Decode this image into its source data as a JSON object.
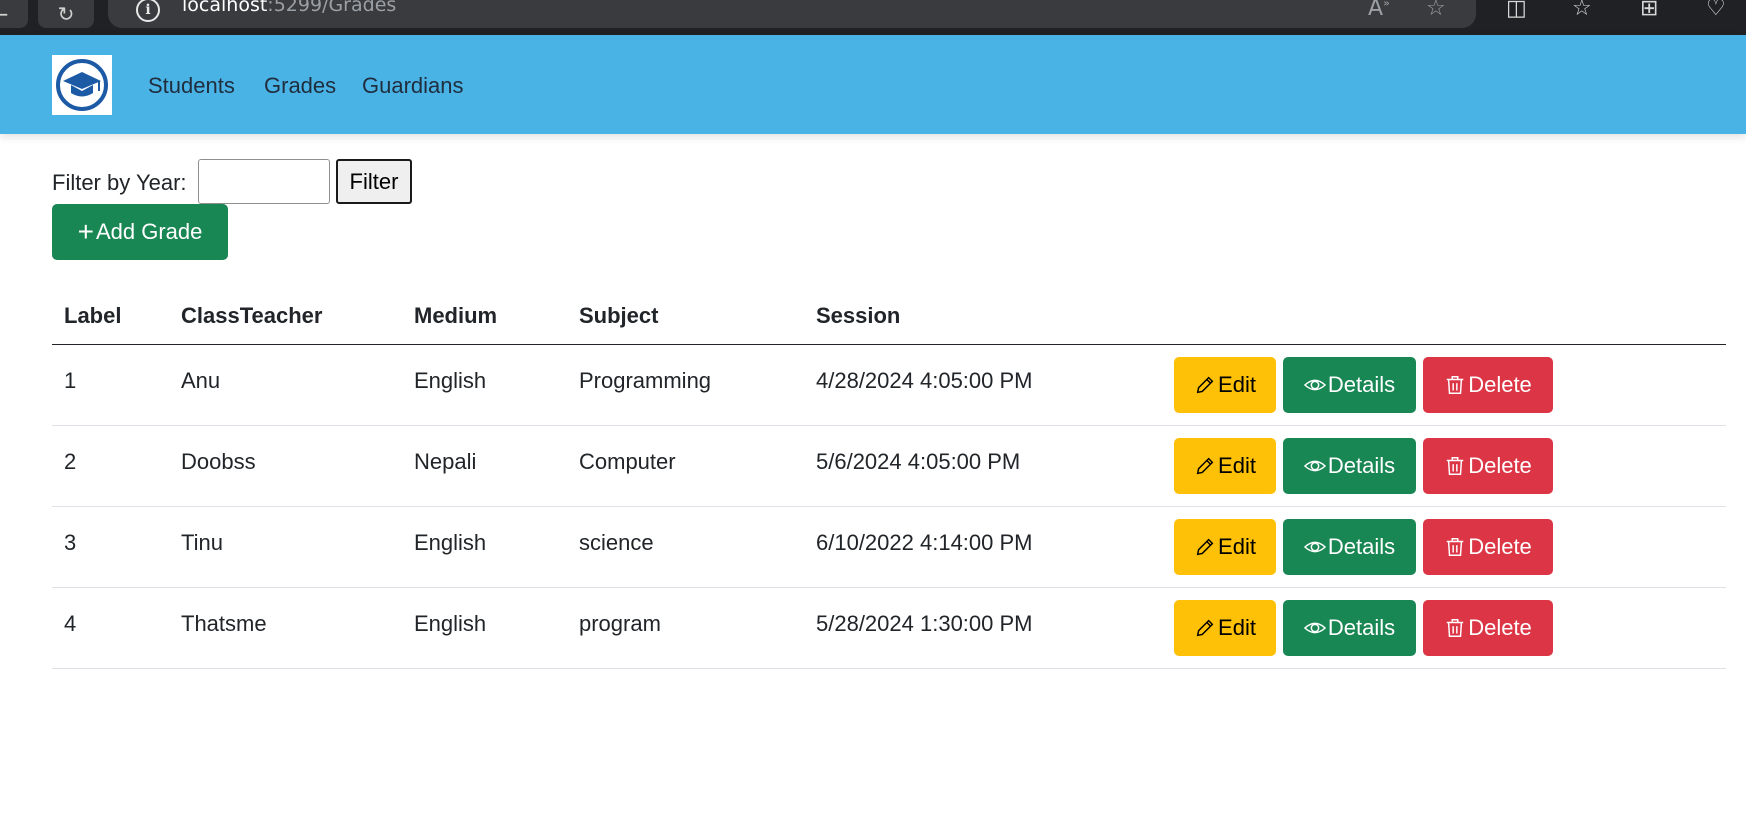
{
  "browser": {
    "url_host": "localhost",
    "url_path": ":5299/Grades"
  },
  "navbar": {
    "links": [
      "Students",
      "Grades",
      "Guardians"
    ]
  },
  "filter": {
    "label": "Filter by Year:",
    "input_value": "",
    "button_label": "Filter"
  },
  "add_button_label": "Add Grade",
  "table": {
    "headers": [
      "Label",
      "ClassTeacher",
      "Medium",
      "Subject",
      "Session"
    ],
    "rows": [
      [
        "1",
        "Anu",
        "English",
        "Programming",
        "4/28/2024 4:05:00 PM"
      ],
      [
        "2",
        "Doobss",
        "Nepali",
        "Computer",
        "5/6/2024 4:05:00 PM"
      ],
      [
        "3",
        "Tinu",
        "English",
        "science",
        "6/10/2022 4:14:00 PM"
      ],
      [
        "4",
        "Thatsme",
        "English",
        "program",
        "5/28/2024 1:30:00 PM"
      ]
    ],
    "actions": {
      "edit": "Edit",
      "details": "Details",
      "delete": "Delete"
    }
  },
  "colors": {
    "navbar": "#4ab3e6",
    "success": "#198754",
    "warning": "#ffc107",
    "danger": "#dc3545"
  }
}
